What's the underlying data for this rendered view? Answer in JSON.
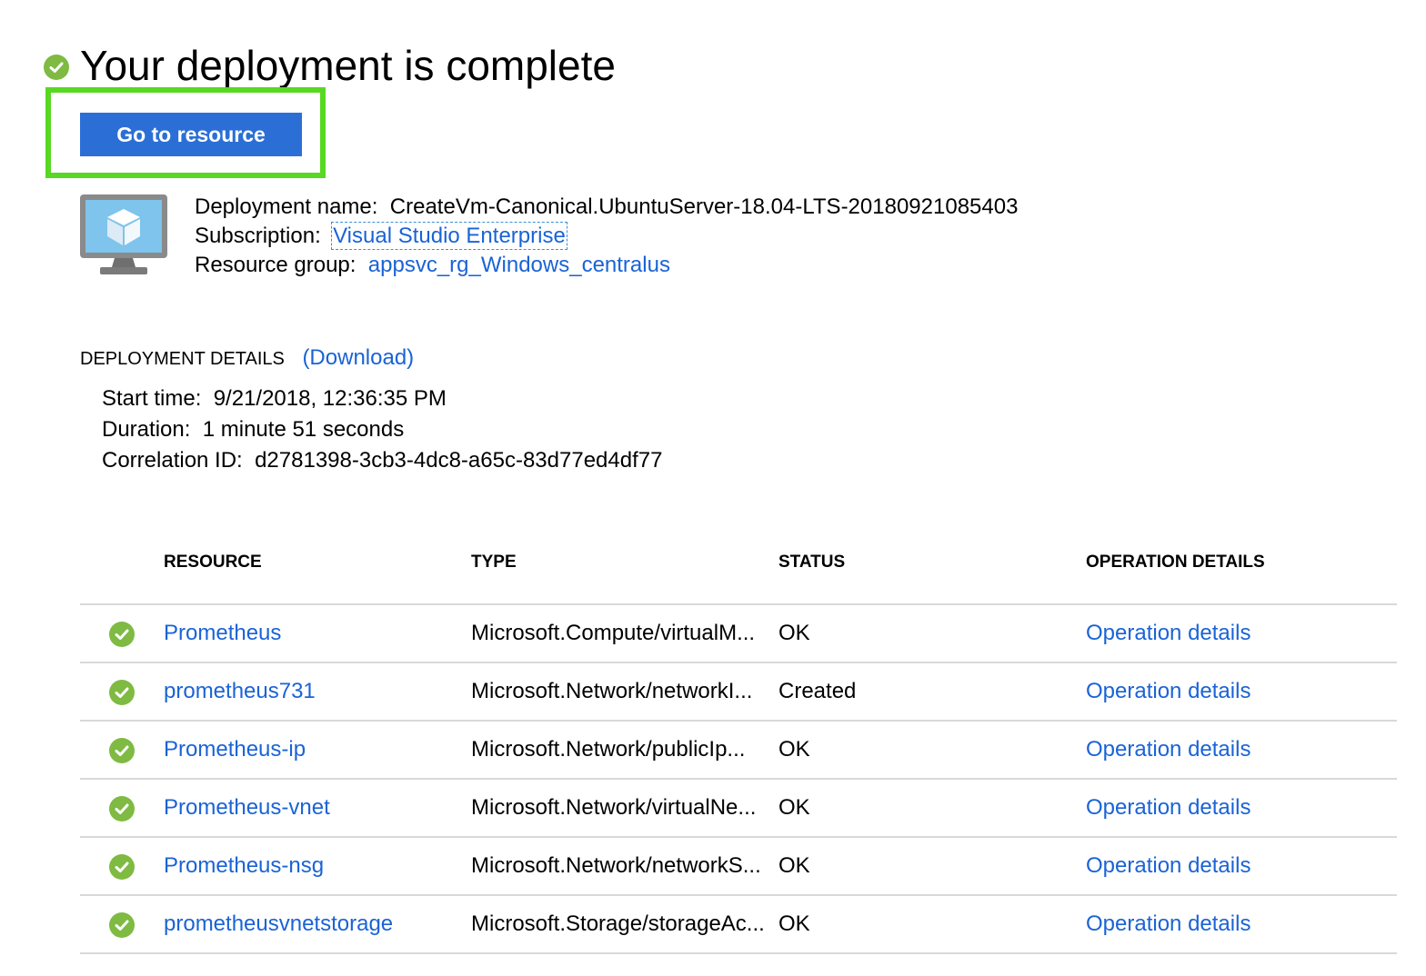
{
  "header": {
    "title": "Your deployment is complete",
    "status_icon": "check-circle-icon",
    "status_color": "#7fba42"
  },
  "actions": {
    "go_to_resource_label": "Go to resource",
    "button_color": "#2b6fd6",
    "highlight_color": "#58d823"
  },
  "summary": {
    "icon": "virtual-machine-icon",
    "deployment_name_label": "Deployment name:",
    "deployment_name_value": "CreateVm-Canonical.UbuntuServer-18.04-LTS-20180921085403",
    "subscription_label": "Subscription:",
    "subscription_value": "Visual Studio Enterprise",
    "resource_group_label": "Resource group:",
    "resource_group_value": "appsvc_rg_Windows_centralus"
  },
  "details": {
    "heading": "DEPLOYMENT DETAILS",
    "download_label": "(Download)",
    "start_time_label": "Start time:",
    "start_time_value": "9/21/2018, 12:36:35 PM",
    "duration_label": "Duration:",
    "duration_value": "1 minute 51 seconds",
    "correlation_label": "Correlation ID:",
    "correlation_value": "d2781398-3cb3-4dc8-a65c-83d77ed4df77"
  },
  "table": {
    "columns": [
      "RESOURCE",
      "TYPE",
      "STATUS",
      "OPERATION DETAILS"
    ],
    "rows": [
      {
        "resource": "Prometheus",
        "type": "Microsoft.Compute/virtualM...",
        "status": "OK",
        "operation": "Operation details"
      },
      {
        "resource": "prometheus731",
        "type": "Microsoft.Network/networkI...",
        "status": "Created",
        "operation": "Operation details"
      },
      {
        "resource": "Prometheus-ip",
        "type": "Microsoft.Network/publicIp...",
        "status": "OK",
        "operation": "Operation details"
      },
      {
        "resource": "Prometheus-vnet",
        "type": "Microsoft.Network/virtualNe...",
        "status": "OK",
        "operation": "Operation details"
      },
      {
        "resource": "Prometheus-nsg",
        "type": "Microsoft.Network/networkS...",
        "status": "OK",
        "operation": "Operation details"
      },
      {
        "resource": "prometheusvnetstorage",
        "type": "Microsoft.Storage/storageAc...",
        "status": "OK",
        "operation": "Operation details"
      }
    ]
  }
}
